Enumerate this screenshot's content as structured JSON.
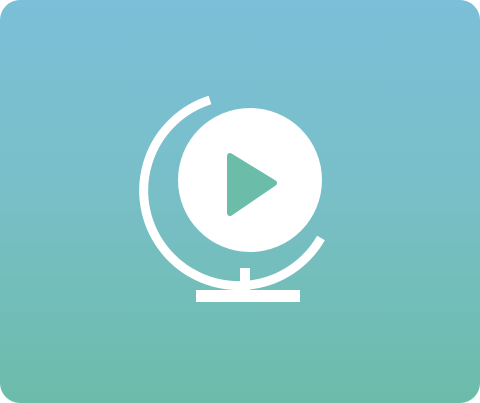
{
  "app": {
    "icon_name": "globe-play-icon",
    "colors": {
      "gradient_top": "#7bbfd8",
      "gradient_bottom": "#6cbcaa",
      "mark": "#ffffff",
      "play": "#6cbcaa"
    }
  }
}
